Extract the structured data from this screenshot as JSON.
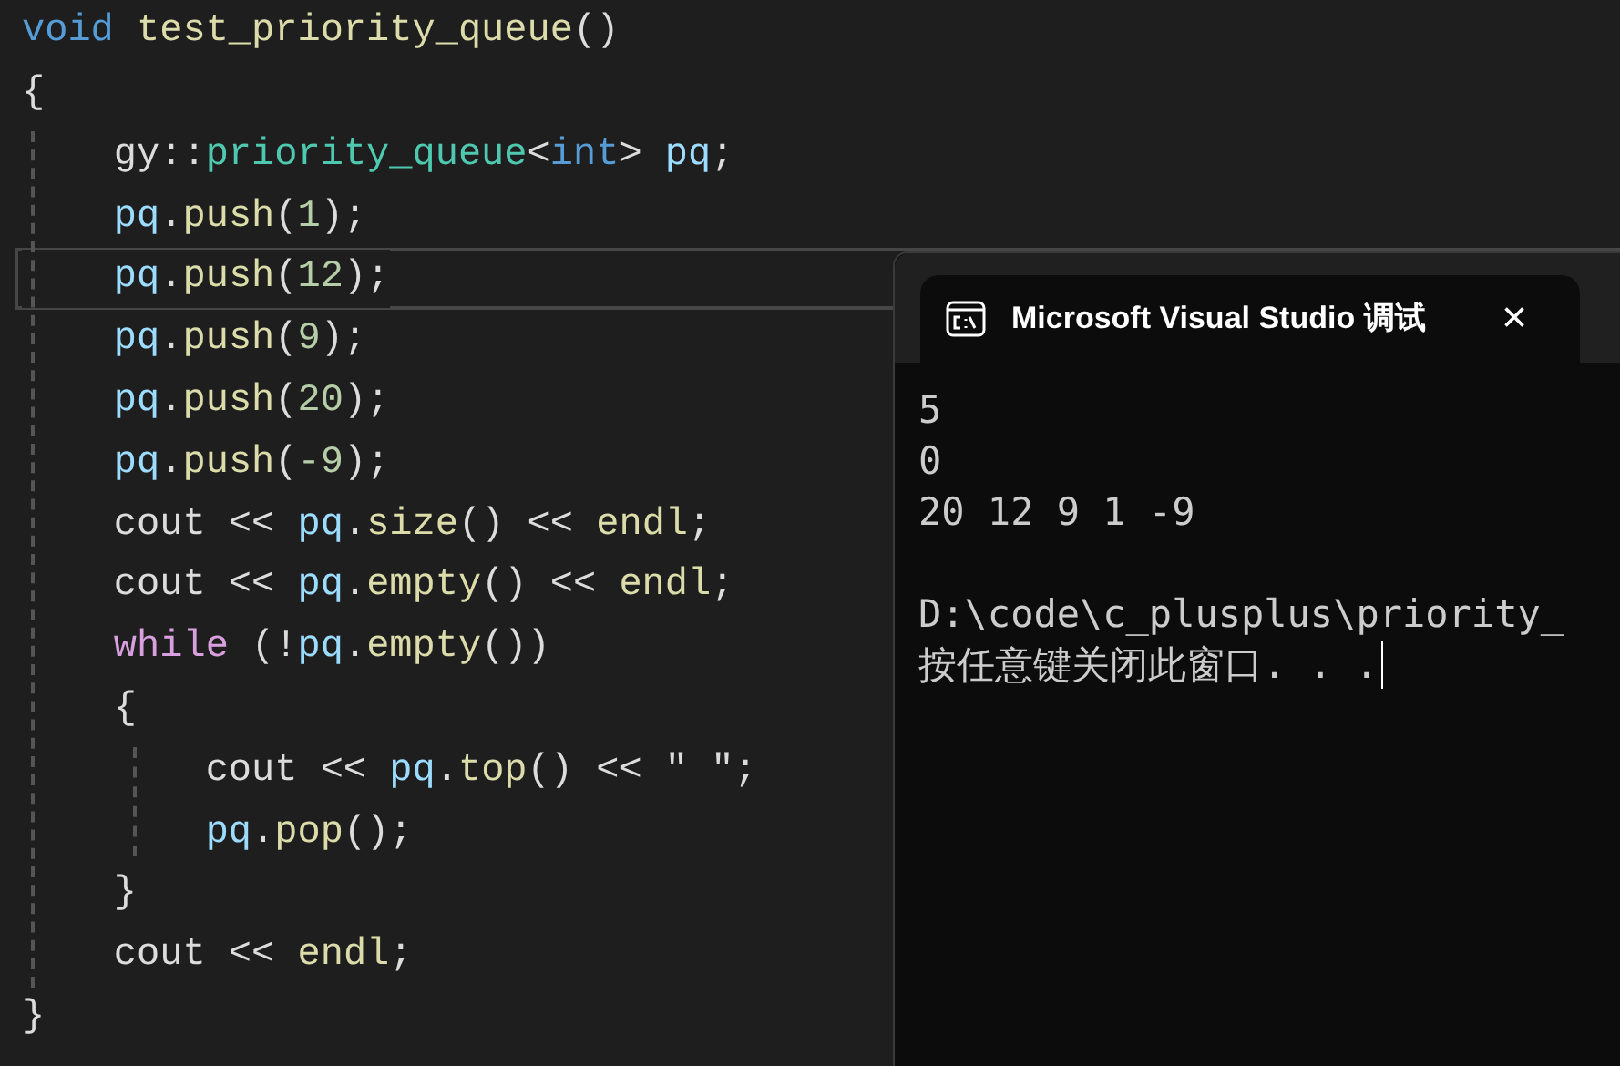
{
  "editor": {
    "lines": [
      {
        "current": false,
        "tokens": [
          {
            "kind": "keyword",
            "text": "void "
          },
          {
            "kind": "function",
            "text": "test_priority_queue"
          },
          {
            "kind": "plain",
            "text": "()"
          }
        ]
      },
      {
        "current": false,
        "tokens": [
          {
            "kind": "plain",
            "text": "{"
          }
        ]
      },
      {
        "current": false,
        "tokens": [
          {
            "kind": "plain",
            "text": "    gy::"
          },
          {
            "kind": "type",
            "text": "priority_queue"
          },
          {
            "kind": "plain",
            "text": "<"
          },
          {
            "kind": "keyword",
            "text": "int"
          },
          {
            "kind": "plain",
            "text": "> "
          },
          {
            "kind": "variable",
            "text": "pq"
          },
          {
            "kind": "plain",
            "text": ";"
          }
        ]
      },
      {
        "current": false,
        "tokens": [
          {
            "kind": "variable",
            "text": "    pq"
          },
          {
            "kind": "plain",
            "text": "."
          },
          {
            "kind": "function",
            "text": "push"
          },
          {
            "kind": "plain",
            "text": "("
          },
          {
            "kind": "number",
            "text": "1"
          },
          {
            "kind": "plain",
            "text": ");"
          }
        ]
      },
      {
        "current": true,
        "tokens": [
          {
            "kind": "variable",
            "text": "    pq"
          },
          {
            "kind": "plain",
            "text": "."
          },
          {
            "kind": "function",
            "text": "push"
          },
          {
            "kind": "plain",
            "text": "("
          },
          {
            "kind": "number",
            "text": "12"
          },
          {
            "kind": "plain",
            "text": ");"
          }
        ]
      },
      {
        "current": false,
        "tokens": [
          {
            "kind": "variable",
            "text": "    pq"
          },
          {
            "kind": "plain",
            "text": "."
          },
          {
            "kind": "function",
            "text": "push"
          },
          {
            "kind": "plain",
            "text": "("
          },
          {
            "kind": "number",
            "text": "9"
          },
          {
            "kind": "plain",
            "text": ");"
          }
        ]
      },
      {
        "current": false,
        "tokens": [
          {
            "kind": "variable",
            "text": "    pq"
          },
          {
            "kind": "plain",
            "text": "."
          },
          {
            "kind": "function",
            "text": "push"
          },
          {
            "kind": "plain",
            "text": "("
          },
          {
            "kind": "number",
            "text": "20"
          },
          {
            "kind": "plain",
            "text": ");"
          }
        ]
      },
      {
        "current": false,
        "tokens": [
          {
            "kind": "variable",
            "text": "    pq"
          },
          {
            "kind": "plain",
            "text": "."
          },
          {
            "kind": "function",
            "text": "push"
          },
          {
            "kind": "plain",
            "text": "("
          },
          {
            "kind": "number",
            "text": "-9"
          },
          {
            "kind": "plain",
            "text": ");"
          }
        ]
      },
      {
        "current": false,
        "tokens": [
          {
            "kind": "plain",
            "text": "    cout << "
          },
          {
            "kind": "variable",
            "text": "pq"
          },
          {
            "kind": "plain",
            "text": "."
          },
          {
            "kind": "function",
            "text": "size"
          },
          {
            "kind": "plain",
            "text": "() << "
          },
          {
            "kind": "function",
            "text": "endl"
          },
          {
            "kind": "plain",
            "text": ";"
          }
        ]
      },
      {
        "current": false,
        "tokens": [
          {
            "kind": "plain",
            "text": "    cout << "
          },
          {
            "kind": "variable",
            "text": "pq"
          },
          {
            "kind": "plain",
            "text": "."
          },
          {
            "kind": "function",
            "text": "empty"
          },
          {
            "kind": "plain",
            "text": "() << "
          },
          {
            "kind": "function",
            "text": "endl"
          },
          {
            "kind": "plain",
            "text": ";"
          }
        ]
      },
      {
        "current": false,
        "tokens": [
          {
            "kind": "control",
            "text": "    while"
          },
          {
            "kind": "plain",
            "text": " (!"
          },
          {
            "kind": "variable",
            "text": "pq"
          },
          {
            "kind": "plain",
            "text": "."
          },
          {
            "kind": "function",
            "text": "empty"
          },
          {
            "kind": "plain",
            "text": "())"
          }
        ]
      },
      {
        "current": false,
        "tokens": [
          {
            "kind": "plain",
            "text": "    {"
          }
        ]
      },
      {
        "current": false,
        "tokens": [
          {
            "kind": "plain",
            "text": "        cout << "
          },
          {
            "kind": "variable",
            "text": "pq"
          },
          {
            "kind": "plain",
            "text": "."
          },
          {
            "kind": "function",
            "text": "top"
          },
          {
            "kind": "plain",
            "text": "() << ″ ″;"
          }
        ]
      },
      {
        "current": false,
        "tokens": [
          {
            "kind": "variable",
            "text": "        pq"
          },
          {
            "kind": "plain",
            "text": "."
          },
          {
            "kind": "function",
            "text": "pop"
          },
          {
            "kind": "plain",
            "text": "();"
          }
        ]
      },
      {
        "current": false,
        "tokens": [
          {
            "kind": "plain",
            "text": "    }"
          }
        ]
      },
      {
        "current": false,
        "tokens": [
          {
            "kind": "plain",
            "text": "    cout << "
          },
          {
            "kind": "function",
            "text": "endl"
          },
          {
            "kind": "plain",
            "text": ";"
          }
        ]
      },
      {
        "current": false,
        "tokens": [
          {
            "kind": "plain",
            "text": "}"
          }
        ]
      }
    ]
  },
  "console": {
    "tab_title": "Microsoft Visual Studio 调试",
    "close": "×",
    "output": [
      "5",
      "0",
      "20 12 9 1 -9",
      "D:\\code\\c_plusplus\\priority_",
      "按任意键关闭此窗口. . ."
    ]
  }
}
